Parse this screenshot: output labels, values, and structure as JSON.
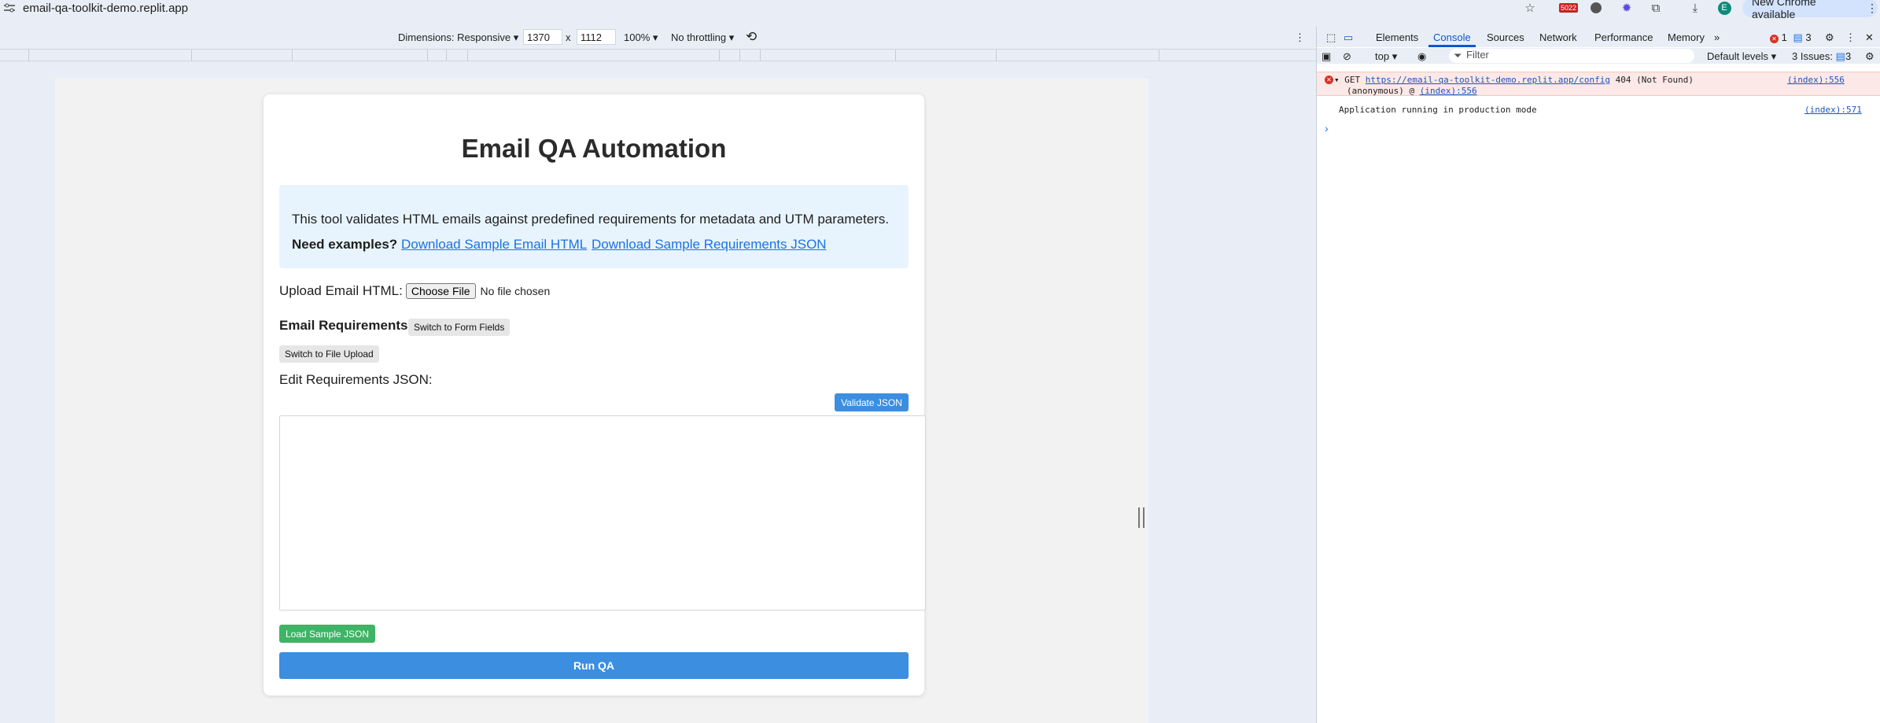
{
  "browser": {
    "url": "email-qa-toolkit-demo.replit.app",
    "badge": "5022",
    "update_button": "New Chrome available",
    "profile_initial": "E"
  },
  "device_toolbar": {
    "dimensions": "Dimensions: Responsive",
    "width": "1370",
    "times": "x",
    "height": "1112",
    "zoom": "100%",
    "throttling": "No throttling"
  },
  "app": {
    "title": "Email QA Automation",
    "description": "This tool validates HTML emails against predefined requirements for metadata and UTM parameters.",
    "examples_label": "Need examples?",
    "sample_email_link": "Download Sample Email HTML",
    "sample_json_link": "Download Sample Requirements JSON",
    "upload_label": "Upload Email HTML:",
    "choose_file": "Choose File",
    "no_file": "No file chosen",
    "requirements_title": "Email Requirements",
    "switch_form": "Switch to Form Fields",
    "switch_upload": "Switch to File Upload",
    "edit_json_label": "Edit Requirements JSON:",
    "validate_json": "Validate JSON",
    "json_value": "",
    "load_sample": "Load Sample JSON",
    "run_qa": "Run QA"
  },
  "devtools": {
    "tabs": [
      "Elements",
      "Console",
      "Sources",
      "Network",
      "Performance",
      "Memory"
    ],
    "active_tab": "Console",
    "more": "»",
    "error_count": "1",
    "message_count": "3",
    "context": "top",
    "filter_placeholder": "Filter",
    "levels": "Default levels",
    "issues": "3 Issues:",
    "issues_count": "3",
    "error": {
      "method": "GET",
      "url": "https://email-qa-toolkit-demo.replit.app/config",
      "status": "404 (Not Found)",
      "source": "(index):556",
      "stack_prefix": "(anonymous) @",
      "stack_link": "(index):556"
    },
    "log": {
      "text": "Application running in production mode",
      "source": "(index):571"
    },
    "prompt": "›"
  },
  "colors": {
    "primary_blue": "#3b8ee0",
    "success_green": "#3fb366",
    "info_bg": "#e8f4fd",
    "error_bg": "#fce8e6"
  }
}
